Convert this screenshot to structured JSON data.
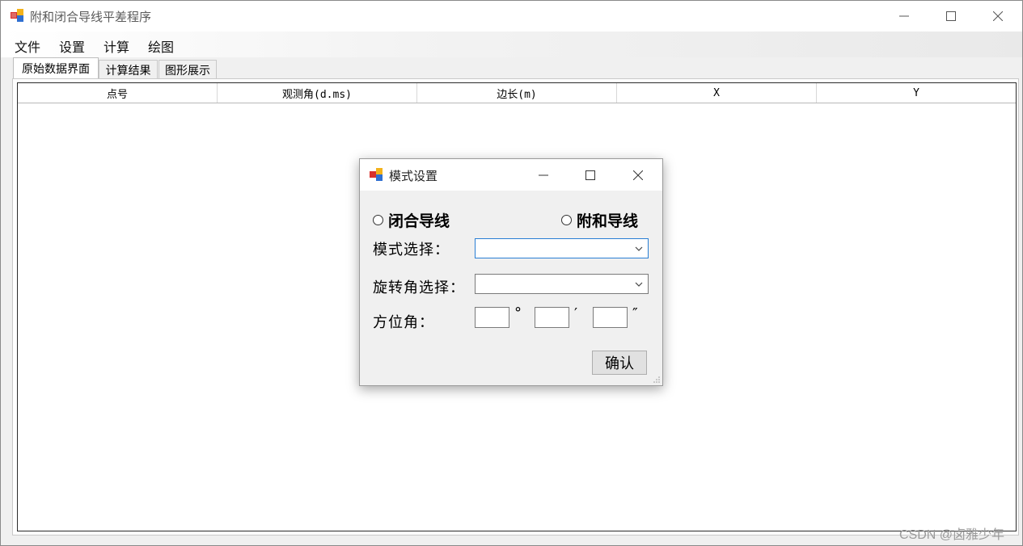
{
  "window": {
    "title": "附和闭合导线平差程序",
    "icon": "winforms-app-icon"
  },
  "menu": [
    "文件",
    "设置",
    "计算",
    "绘图"
  ],
  "tabs": [
    "原始数据界面",
    "计算结果",
    "图形展示"
  ],
  "active_tab": "原始数据界面",
  "grid": {
    "columns": [
      "点号",
      "观测角(d.ms)",
      "边长(m)",
      "X",
      "Y"
    ],
    "rows": []
  },
  "dialog": {
    "title": "模式设置",
    "radio_closed": "闭合导线",
    "radio_attached": "附和导线",
    "mode_label": "模式选择：",
    "mode_value": "",
    "rotation_label": "旋转角选择：",
    "rotation_value": "",
    "azimuth_label": "方位角：",
    "deg_symbol": "°",
    "min_symbol": "′",
    "sec_symbol": "″",
    "confirm": "确认"
  },
  "watermark": "CSDN @卤雅少年",
  "colors": {
    "focus_border": "#2a7fd4",
    "window_bg": "#f0f0f0"
  }
}
